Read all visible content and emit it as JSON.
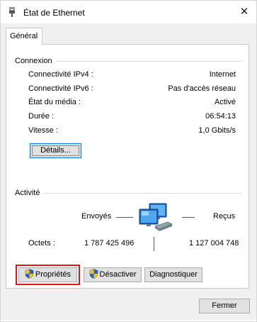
{
  "window": {
    "title": "État de Ethernet",
    "close_glyph": "✕"
  },
  "tabs": [
    {
      "label": "Général"
    }
  ],
  "connexion": {
    "group_label": "Connexion",
    "rows": [
      {
        "label": "Connectivité IPv4 :",
        "value": "Internet"
      },
      {
        "label": "Connectivité IPv6 :",
        "value": "Pas d'accès réseau"
      },
      {
        "label": "État du média :",
        "value": "Activé"
      },
      {
        "label": "Durée :",
        "value": "06:54:13"
      },
      {
        "label": "Vitesse :",
        "value": "1,0 Gbits/s"
      }
    ],
    "details_button": "Détails..."
  },
  "activite": {
    "group_label": "Activité",
    "sent_label": "Envoyés",
    "received_label": "Reçus",
    "bytes_label": "Octets :",
    "bytes_sent": "1 787 425 496",
    "bytes_received": "1 127 004 748",
    "icon": "network-computers-icon"
  },
  "actions": {
    "properties": "Propriétés",
    "disable": "Désactiver",
    "diagnose": "Diagnostiquer",
    "icon": "uac-shield-icon"
  },
  "footer": {
    "close_button": "Fermer"
  },
  "colors": {
    "highlight": "#e0151b",
    "focus": "#0078d7",
    "panel_bg": "#f0f0f0"
  }
}
